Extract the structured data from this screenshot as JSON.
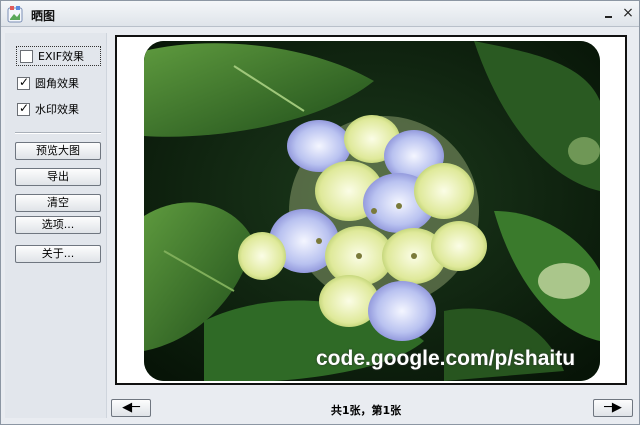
{
  "window": {
    "title": "晒图"
  },
  "sidebar": {
    "options": [
      {
        "label": "EXIF效果",
        "checked": false
      },
      {
        "label": "圆角效果",
        "checked": true
      },
      {
        "label": "水印效果",
        "checked": true
      }
    ],
    "buttons": {
      "preview": "预览大图",
      "export": "导出",
      "clear": "清空",
      "options": "选项...",
      "about": "关于..."
    }
  },
  "preview": {
    "watermark": "code.google.com/p/shaitu",
    "subject": "hydrangea-photo"
  },
  "footer": {
    "prev_icon": "left-arrow-icon",
    "next_icon": "right-arrow-icon",
    "status": "共1张，第1张"
  }
}
